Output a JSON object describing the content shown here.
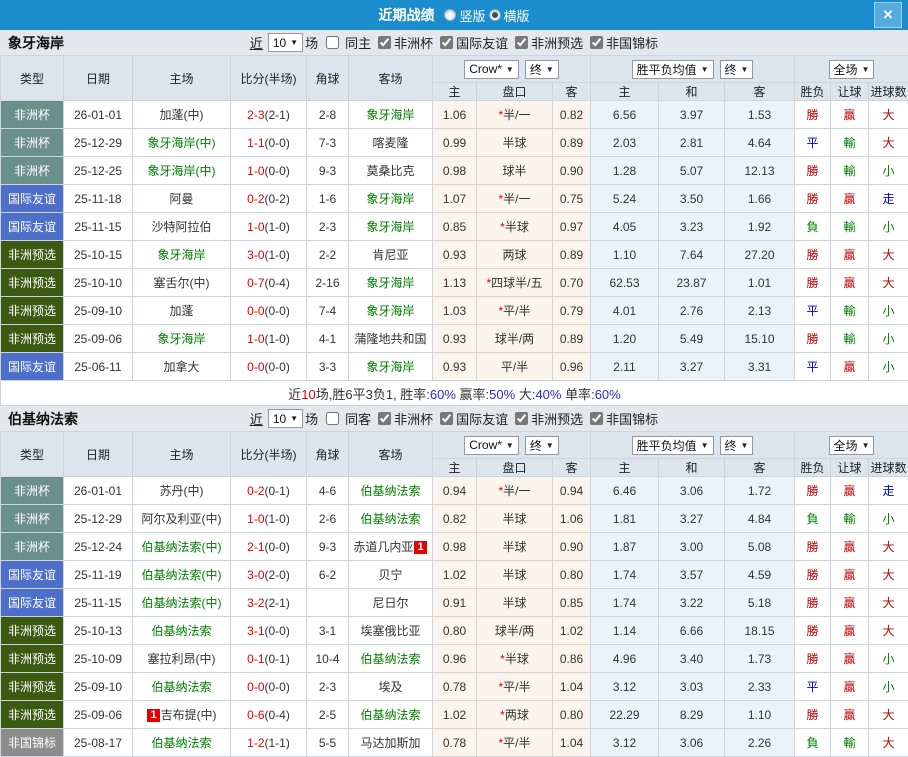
{
  "titlebar": {
    "title": "近期战绩",
    "radios": [
      {
        "label": "竖版",
        "selected": false
      },
      {
        "label": "横版",
        "selected": true
      }
    ]
  },
  "icons": {
    "dropdown_arrow": "▼",
    "close": "×"
  },
  "filter": {
    "near_label": "近",
    "count_value": "10",
    "games_label": "场",
    "leagues": [
      "非洲杯",
      "国际友谊",
      "非洲预选",
      "非国锦标"
    ]
  },
  "header": {
    "type": "类型",
    "date": "日期",
    "home": "主场",
    "score": "比分(半场)",
    "corner": "角球",
    "away": "客场",
    "crow_select": "Crow*",
    "final_select": "终",
    "wdl_select": "胜平负均值",
    "full_select": "全场",
    "odds_home": "主",
    "handicap": "盘口",
    "odds_away": "客",
    "avg_home": "主",
    "avg_draw": "和",
    "avg_away": "客",
    "result": "胜负",
    "let_ball": "让球",
    "goals": "进球数"
  },
  "type_colors": {
    "非洲杯": "#6b8f8a",
    "国际友谊": "#4e6fc9",
    "非洲预选": "#3d5a12",
    "非国锦标": "#8c8c8c"
  },
  "result_colors": {
    "勝": "#c00000",
    "贏": "#c00000",
    "大": "#c00000",
    "平": "#0000cc",
    "走": "#0000cc",
    "負": "#008000",
    "輸": "#008000",
    "小": "#008000"
  },
  "sections": [
    {
      "team": "象牙海岸",
      "same_label": "同主",
      "same_checked": false,
      "rows": [
        {
          "league": "非洲杯",
          "date": "26-01-01",
          "home": "加蓬(中)",
          "home_focal": false,
          "score": "2-3",
          "half": "(2-1)",
          "corner": "2-8",
          "away": "象牙海岸",
          "away_focal": true,
          "odds": [
            "1.06",
            "*半/一",
            "0.82"
          ],
          "avg": [
            "6.56",
            "3.97",
            "1.53"
          ],
          "res": [
            "勝",
            "贏",
            "大"
          ]
        },
        {
          "league": "非洲杯",
          "date": "25-12-29",
          "home": "象牙海岸(中)",
          "home_focal": true,
          "score": "1-1",
          "half": "(0-0)",
          "corner": "7-3",
          "away": "喀麦隆",
          "away_focal": false,
          "odds": [
            "0.99",
            "半球",
            "0.89"
          ],
          "avg": [
            "2.03",
            "2.81",
            "4.64"
          ],
          "res": [
            "平",
            "輸",
            "大"
          ]
        },
        {
          "league": "非洲杯",
          "date": "25-12-25",
          "home": "象牙海岸(中)",
          "home_focal": true,
          "score": "1-0",
          "half": "(0-0)",
          "corner": "9-3",
          "away": "莫桑比克",
          "away_focal": false,
          "odds": [
            "0.98",
            "球半",
            "0.90"
          ],
          "avg": [
            "1.28",
            "5.07",
            "12.13"
          ],
          "res": [
            "勝",
            "輸",
            "小"
          ]
        },
        {
          "league": "国际友谊",
          "date": "25-11-18",
          "home": "阿曼",
          "home_focal": false,
          "score": "0-2",
          "half": "(0-2)",
          "corner": "1-6",
          "away": "象牙海岸",
          "away_focal": true,
          "odds": [
            "1.07",
            "*半/一",
            "0.75"
          ],
          "avg": [
            "5.24",
            "3.50",
            "1.66"
          ],
          "res": [
            "勝",
            "贏",
            "走"
          ]
        },
        {
          "league": "国际友谊",
          "date": "25-11-15",
          "home": "沙特阿拉伯",
          "home_focal": false,
          "score": "1-0",
          "half": "(1-0)",
          "corner": "2-3",
          "away": "象牙海岸",
          "away_focal": true,
          "odds": [
            "0.85",
            "*半球",
            "0.97"
          ],
          "avg": [
            "4.05",
            "3.23",
            "1.92"
          ],
          "res": [
            "負",
            "輸",
            "小"
          ]
        },
        {
          "league": "非洲预选",
          "date": "25-10-15",
          "home": "象牙海岸",
          "home_focal": true,
          "score": "3-0",
          "half": "(1-0)",
          "corner": "2-2",
          "away": "肯尼亚",
          "away_focal": false,
          "odds": [
            "0.93",
            "两球",
            "0.89"
          ],
          "avg": [
            "1.10",
            "7.64",
            "27.20"
          ],
          "res": [
            "勝",
            "贏",
            "大"
          ]
        },
        {
          "league": "非洲预选",
          "date": "25-10-10",
          "home": "塞舌尔(中)",
          "home_focal": false,
          "score": "0-7",
          "half": "(0-4)",
          "corner": "2-16",
          "away": "象牙海岸",
          "away_focal": true,
          "odds": [
            "1.13",
            "*四球半/五",
            "0.70"
          ],
          "avg": [
            "62.53",
            "23.87",
            "1.01"
          ],
          "res": [
            "勝",
            "贏",
            "大"
          ]
        },
        {
          "league": "非洲预选",
          "date": "25-09-10",
          "home": "加蓬",
          "home_focal": false,
          "score": "0-0",
          "half": "(0-0)",
          "corner": "7-4",
          "away": "象牙海岸",
          "away_focal": true,
          "odds": [
            "1.03",
            "*平/半",
            "0.79"
          ],
          "avg": [
            "4.01",
            "2.76",
            "2.13"
          ],
          "res": [
            "平",
            "輸",
            "小"
          ]
        },
        {
          "league": "非洲预选",
          "date": "25-09-06",
          "home": "象牙海岸",
          "home_focal": true,
          "score": "1-0",
          "half": "(1-0)",
          "corner": "4-1",
          "away": "蒲隆地共和国",
          "away_focal": false,
          "odds": [
            "0.93",
            "球半/两",
            "0.89"
          ],
          "avg": [
            "1.20",
            "5.49",
            "15.10"
          ],
          "res": [
            "勝",
            "輸",
            "小"
          ]
        },
        {
          "league": "国际友谊",
          "date": "25-06-11",
          "home": "加拿大",
          "home_focal": false,
          "score": "0-0",
          "half": "(0-0)",
          "corner": "3-3",
          "away": "象牙海岸",
          "away_focal": true,
          "odds": [
            "0.93",
            "平/半",
            "0.96"
          ],
          "avg": [
            "2.11",
            "3.27",
            "3.31"
          ],
          "res": [
            "平",
            "贏",
            "小"
          ]
        }
      ],
      "summary": [
        [
          "近",
          "#333333"
        ],
        [
          "10",
          "#e60000"
        ],
        [
          "场,胜6平3负1, 胜率:",
          "#333333"
        ],
        [
          "60%",
          "#2a2ad2"
        ],
        [
          " 赢率:",
          "#333333"
        ],
        [
          "50%",
          "#2a2ad2"
        ],
        [
          " 大:",
          "#333333"
        ],
        [
          "40%",
          "#2a2ad2"
        ],
        [
          " 单率:",
          "#333333"
        ],
        [
          "60%",
          "#2a2ad2"
        ]
      ]
    },
    {
      "team": "伯基纳法索",
      "same_label": "同客",
      "same_checked": false,
      "rows": [
        {
          "league": "非洲杯",
          "date": "26-01-01",
          "home": "苏丹(中)",
          "home_focal": false,
          "score": "0-2",
          "half": "(0-1)",
          "corner": "4-6",
          "away": "伯基纳法索",
          "away_focal": true,
          "odds": [
            "0.94",
            "*半/一",
            "0.94"
          ],
          "avg": [
            "6.46",
            "3.06",
            "1.72"
          ],
          "res": [
            "勝",
            "贏",
            "走"
          ]
        },
        {
          "league": "非洲杯",
          "date": "25-12-29",
          "home": "阿尔及利亚(中)",
          "home_focal": false,
          "score": "1-0",
          "half": "(1-0)",
          "corner": "2-6",
          "away": "伯基纳法索",
          "away_focal": true,
          "odds": [
            "0.82",
            "半球",
            "1.06"
          ],
          "avg": [
            "1.81",
            "3.27",
            "4.84"
          ],
          "res": [
            "負",
            "輸",
            "小"
          ]
        },
        {
          "league": "非洲杯",
          "date": "25-12-24",
          "home": "伯基纳法索(中)",
          "home_focal": true,
          "score": "2-1",
          "half": "(0-0)",
          "corner": "9-3",
          "away": "赤道几内亚",
          "away_focal": false,
          "away_card": {
            "text": "1",
            "pos": "after"
          },
          "odds": [
            "0.98",
            "半球",
            "0.90"
          ],
          "avg": [
            "1.87",
            "3.00",
            "5.08"
          ],
          "res": [
            "勝",
            "贏",
            "大"
          ]
        },
        {
          "league": "国际友谊",
          "date": "25-11-19",
          "home": "伯基纳法索(中)",
          "home_focal": true,
          "score": "3-0",
          "half": "(2-0)",
          "corner": "6-2",
          "away": "贝宁",
          "away_focal": false,
          "odds": [
            "1.02",
            "半球",
            "0.80"
          ],
          "avg": [
            "1.74",
            "3.57",
            "4.59"
          ],
          "res": [
            "勝",
            "贏",
            "大"
          ]
        },
        {
          "league": "国际友谊",
          "date": "25-11-15",
          "home": "伯基纳法索(中)",
          "home_focal": true,
          "score": "3-2",
          "half": "(2-1)",
          "corner": "",
          "away": "尼日尔",
          "away_focal": false,
          "odds": [
            "0.91",
            "半球",
            "0.85"
          ],
          "avg": [
            "1.74",
            "3.22",
            "5.18"
          ],
          "res": [
            "勝",
            "贏",
            "大"
          ]
        },
        {
          "league": "非洲预选",
          "date": "25-10-13",
          "home": "伯基纳法索",
          "home_focal": true,
          "score": "3-1",
          "half": "(0-0)",
          "corner": "3-1",
          "away": "埃塞俄比亚",
          "away_focal": false,
          "odds": [
            "0.80",
            "球半/两",
            "1.02"
          ],
          "avg": [
            "1.14",
            "6.66",
            "18.15"
          ],
          "res": [
            "勝",
            "贏",
            "大"
          ]
        },
        {
          "league": "非洲预选",
          "date": "25-10-09",
          "home": "塞拉利昂(中)",
          "home_focal": false,
          "score": "0-1",
          "half": "(0-1)",
          "corner": "10-4",
          "away": "伯基纳法索",
          "away_focal": true,
          "odds": [
            "0.96",
            "*半球",
            "0.86"
          ],
          "avg": [
            "4.96",
            "3.40",
            "1.73"
          ],
          "res": [
            "勝",
            "贏",
            "小"
          ]
        },
        {
          "league": "非洲预选",
          "date": "25-09-10",
          "home": "伯基纳法索",
          "home_focal": true,
          "score": "0-0",
          "half": "(0-0)",
          "corner": "2-3",
          "away": "埃及",
          "away_focal": false,
          "odds": [
            "0.78",
            "*平/半",
            "1.04"
          ],
          "avg": [
            "3.12",
            "3.03",
            "2.33"
          ],
          "res": [
            "平",
            "贏",
            "小"
          ]
        },
        {
          "league": "非洲预选",
          "date": "25-09-06",
          "home": "吉布提(中)",
          "home_focal": false,
          "home_card": {
            "text": "1",
            "pos": "before"
          },
          "score": "0-6",
          "half": "(0-4)",
          "corner": "2-5",
          "away": "伯基纳法索",
          "away_focal": true,
          "odds": [
            "1.02",
            "*两球",
            "0.80"
          ],
          "avg": [
            "22.29",
            "8.29",
            "1.10"
          ],
          "res": [
            "勝",
            "贏",
            "大"
          ]
        },
        {
          "league": "非国锦标",
          "date": "25-08-17",
          "home": "伯基纳法索",
          "home_focal": true,
          "score": "1-2",
          "half": "(1-1)",
          "corner": "5-5",
          "away": "马达加斯加",
          "away_focal": false,
          "odds": [
            "0.78",
            "*平/半",
            "1.04"
          ],
          "avg": [
            "3.12",
            "3.06",
            "2.26"
          ],
          "res": [
            "負",
            "輸",
            "大"
          ]
        }
      ]
    }
  ]
}
